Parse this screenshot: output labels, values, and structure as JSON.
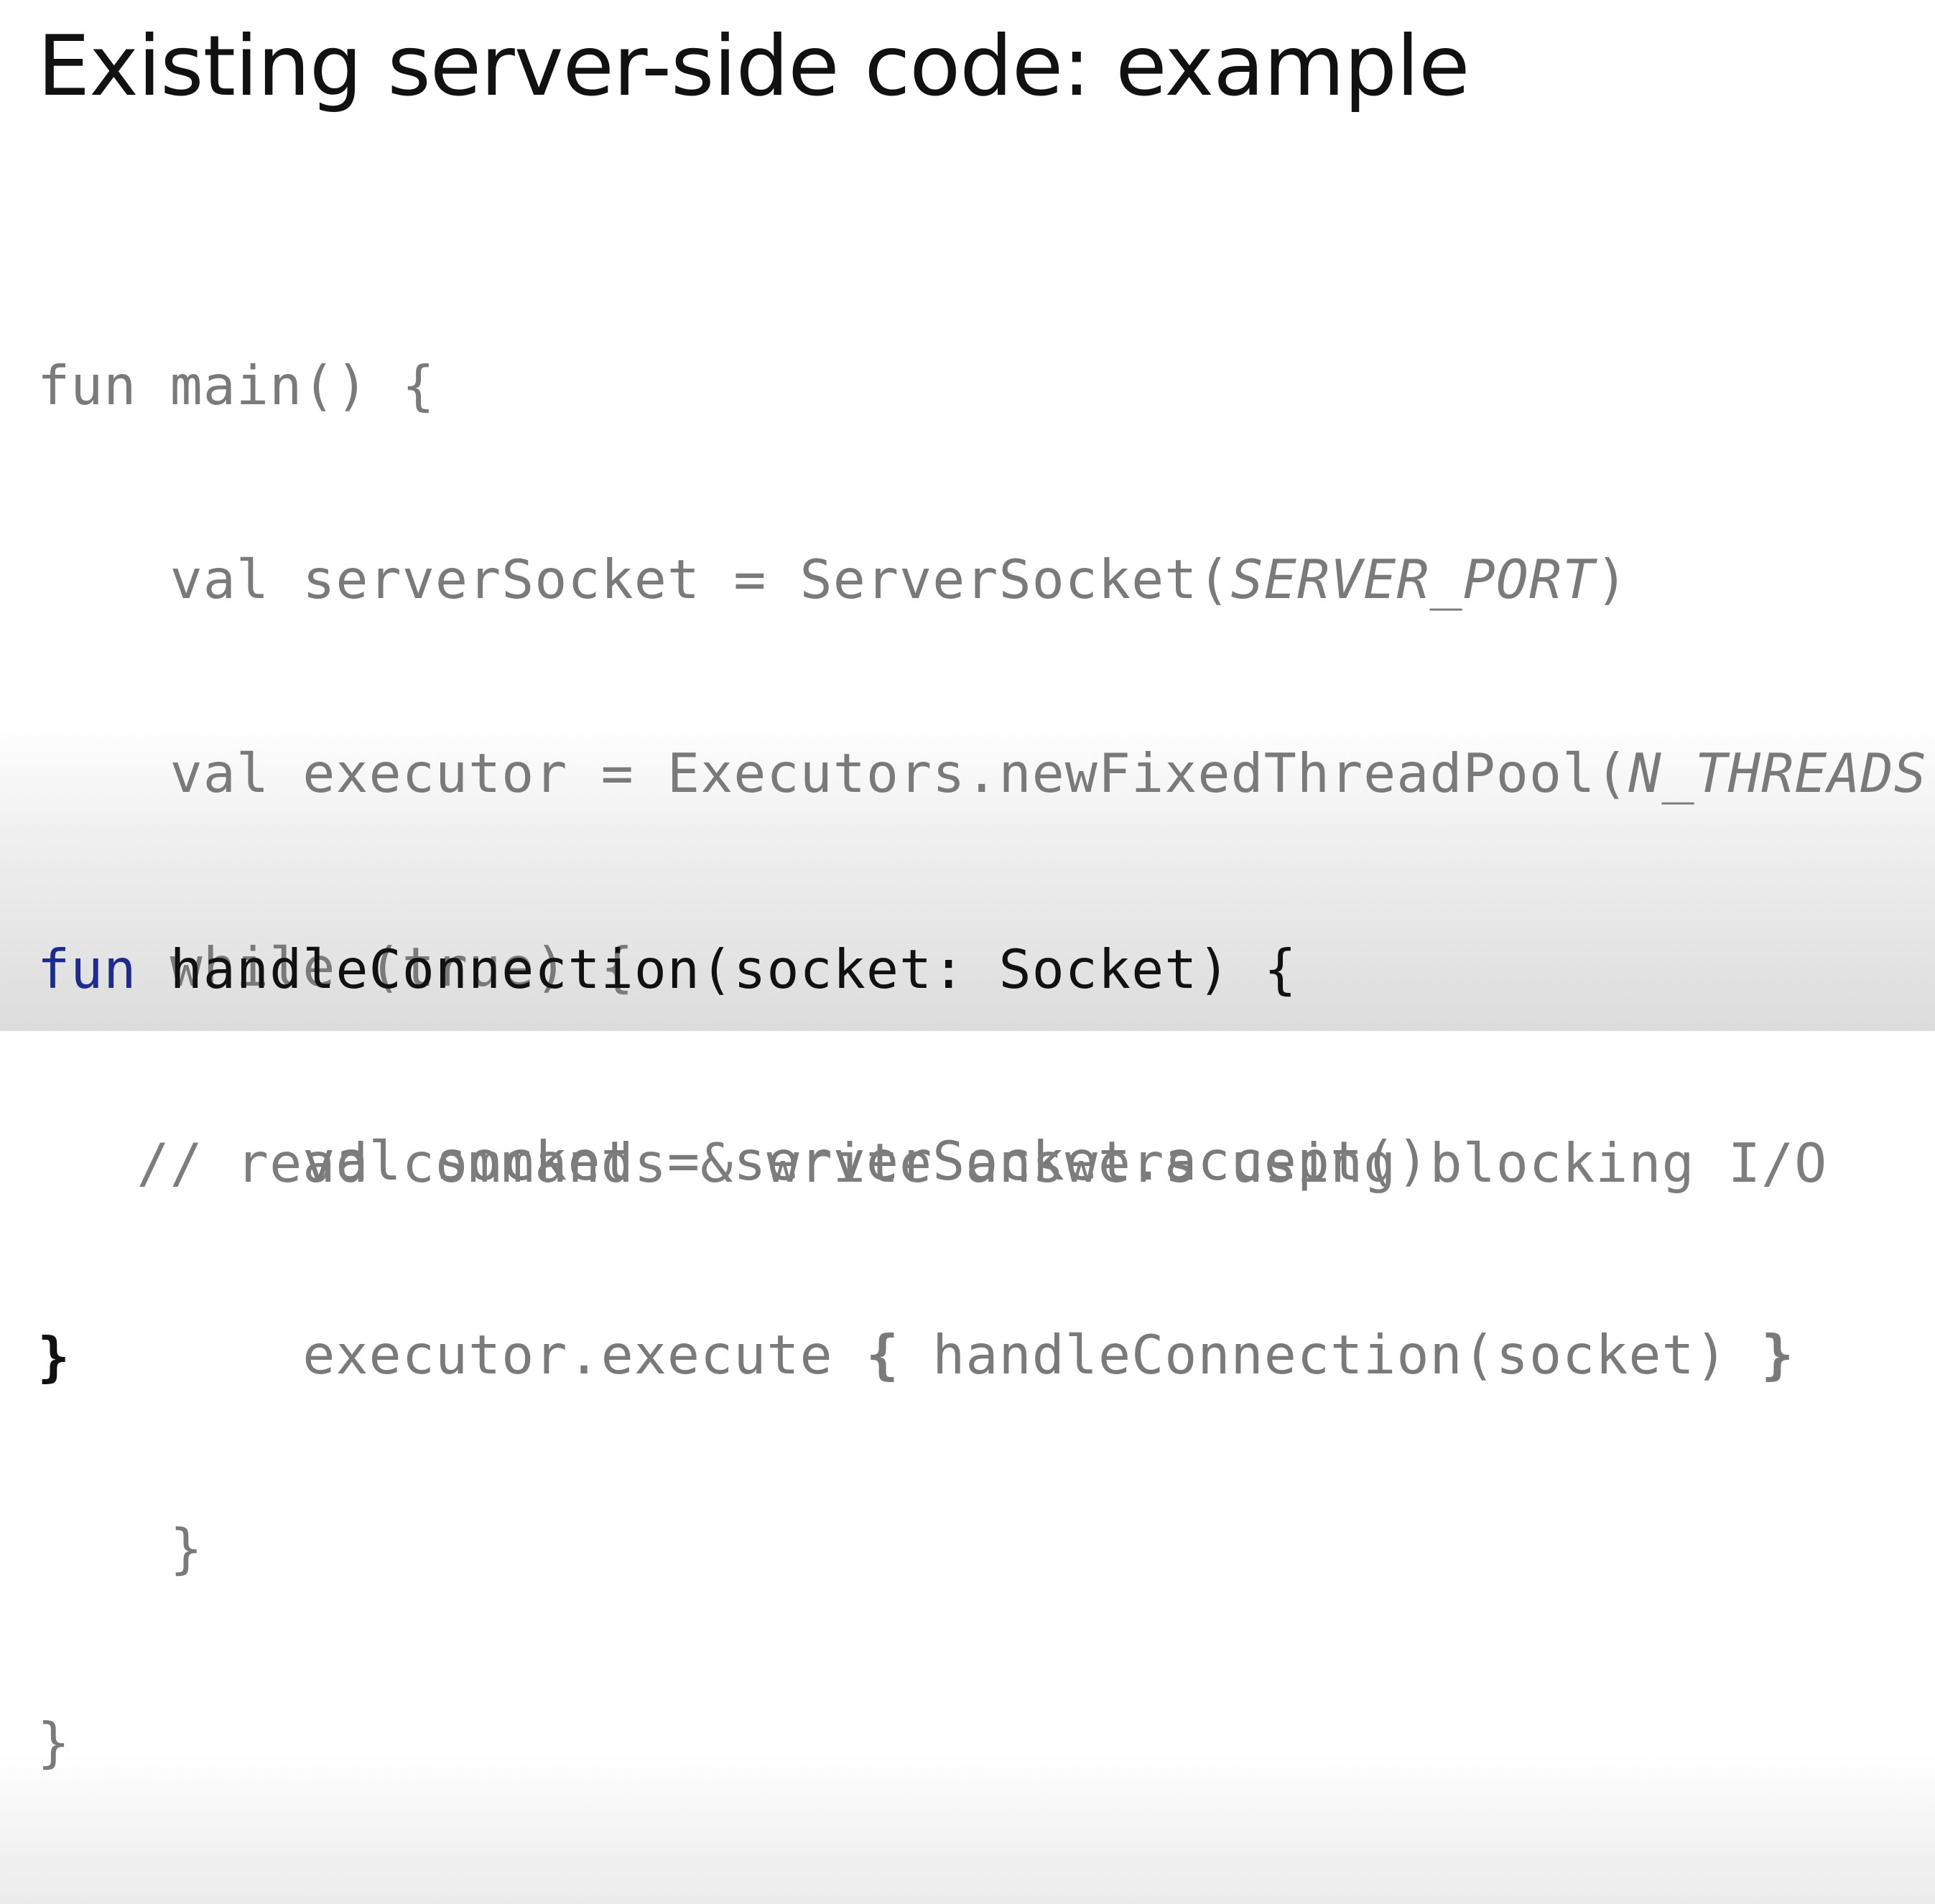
{
  "title": "Existing server-side code: example",
  "code_main": {
    "l1_a": "fun main() {",
    "l2_a": "    val serverSocket = ServerSocket(",
    "l2_b": "SERVER_PORT",
    "l2_c": ")",
    "l3_a": "    val executor = Executors.newFixedThreadPool(",
    "l3_b": "N_THREADS",
    "l3_c": ")",
    "l4_a": "    while (true) {",
    "l5_a": "        val socket = serverSocket.accept()",
    "l6_a": "        executor.execute ",
    "l6_b": "{",
    "l6_c": " handleConnection(socket) ",
    "l6_d": "}",
    "l7_a": "    }",
    "l8_a": "}"
  },
  "code_handler": {
    "l1_kw": "fun",
    "l1_rest": " handleConnection(socket: Socket) {",
    "l2_comment": "   // read commands & write answers using blocking I/O",
    "l3_close": "}"
  },
  "colors": {
    "keyword_blue": "#1d2b8c",
    "code_gray": "#7a7a7a",
    "text_dark": "#111111"
  }
}
